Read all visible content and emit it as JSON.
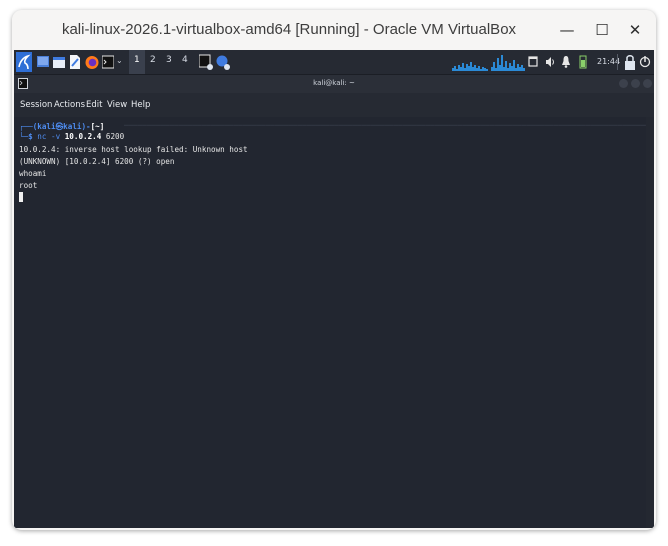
{
  "window": {
    "title": "kali-linux-2026.1-virtualbox-amd64 [Running] - Oracle VM VirtualBox",
    "minimize_glyph": "—",
    "maximize_glyph": "☐",
    "close_glyph": "✕"
  },
  "panel": {
    "workspaces": [
      "1",
      "2",
      "3",
      "4"
    ],
    "active_workspace": "1",
    "clock": "21:44",
    "icons": [
      "kali-menu-icon",
      "desktop-icon",
      "files-icon",
      "text-editor-icon",
      "firefox-icon",
      "terminal-icon",
      "terminal-task-icon",
      "virtualbox-task-icon",
      "cpu-graph-icon",
      "network-graph-icon",
      "window-icon",
      "volume-icon",
      "notifications-icon",
      "battery-icon",
      "power-icon"
    ]
  },
  "terminal": {
    "title": "kali@kali: ~",
    "menu": [
      "Session",
      "Actions",
      "Edit",
      "View",
      "Help"
    ],
    "prompt_user": "(kali㉿kali)",
    "prompt_dir": "[~]",
    "command": "nc -v ",
    "command_host": "10.0.2.4",
    "command_port": " 6200",
    "output": [
      "10.0.2.4: inverse host lookup failed: Unknown host",
      "(UNKNOWN) [10.0.2.4] 6200 (?) open",
      "whoami",
      "root"
    ]
  },
  "colors": {
    "accent": "#4e8cf0",
    "terminal_bg": "#222630",
    "panel_bg": "#262a33"
  }
}
